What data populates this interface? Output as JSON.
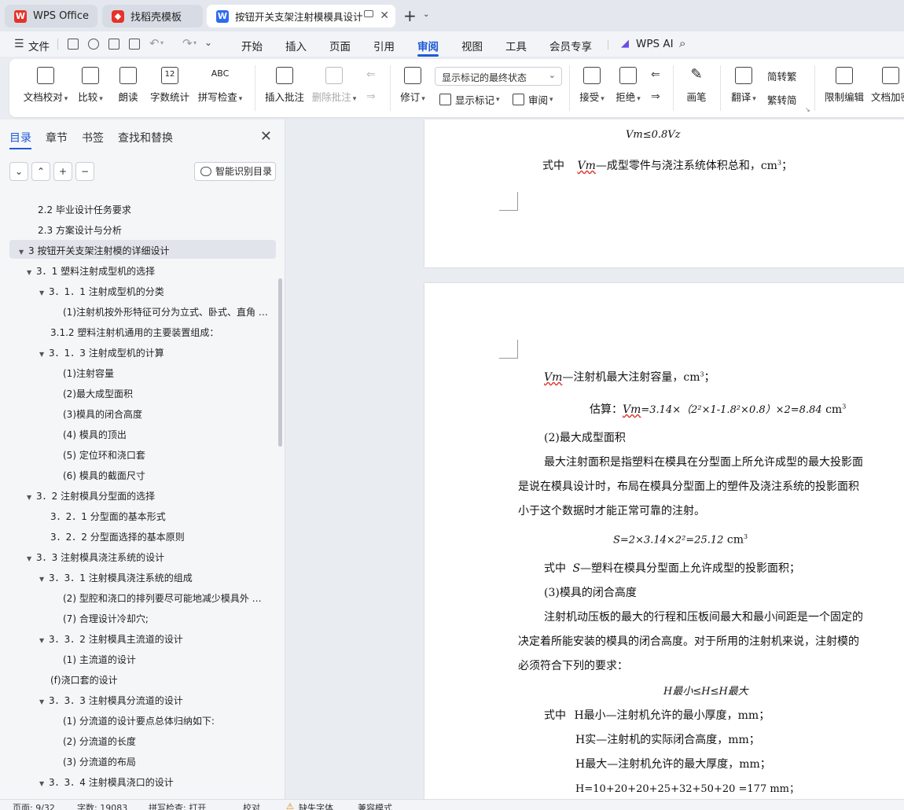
{
  "tabs": [
    {
      "label": "WPS Office",
      "icon": "wps-logo-icon"
    },
    {
      "label": "找稻壳模板",
      "icon": "docer-icon"
    },
    {
      "label": "按钮开关支架注射模模具设计",
      "icon": "writer-doc-icon"
    }
  ],
  "menu": {
    "file": "文件",
    "items": [
      "开始",
      "插入",
      "页面",
      "引用",
      "审阅",
      "视图",
      "工具",
      "会员专享"
    ],
    "active": "审阅",
    "ai": "WPS AI"
  },
  "ribbon": {
    "doc_check": "文档校对",
    "compare": "比较",
    "read_aloud": "朗读",
    "word_count": "字数统计",
    "spell_check": "拼写检查",
    "spell_icon_text": "ABC",
    "word_count_icon_text": "12",
    "insert_comment": "插入批注",
    "delete_comment": "删除批注",
    "track_changes": "修订",
    "markup_dropdown": "显示标记的最终状态",
    "show_markup": "显示标记",
    "review": "审阅",
    "accept": "接受",
    "reject": "拒绝",
    "pen": "画笔",
    "translate": "翻译",
    "to_traditional": "简转繁",
    "to_simplified": "繁转简",
    "restrict_edit": "限制编辑",
    "doc_encrypt": "文档加密"
  },
  "side": {
    "tabs": [
      "目录",
      "章节",
      "书签",
      "查找和替换"
    ],
    "active_tab": "目录",
    "smart_btn": "智能识别目录",
    "toc": [
      {
        "text": "2.2   毕业设计任务要求",
        "level": 1,
        "tri": ""
      },
      {
        "text": "2.3   方案设计与分析",
        "level": 1,
        "tri": ""
      },
      {
        "text": "3   按钮开关支架注射模的详细设计",
        "level": 0,
        "tri": "▼",
        "selected": true
      },
      {
        "text": "3．1   塑料注射成型机的选择",
        "level": 1,
        "tri": "▼"
      },
      {
        "text": "3．1．1   注射成型机的分类",
        "level": 2,
        "tri": "▼"
      },
      {
        "text": "(1)注射机按外形特征可分为立式、卧式、直角 …",
        "level": 3,
        "tri": ""
      },
      {
        "text": "3.1.2   塑料注射机通用的主要装置组成：",
        "level": 2,
        "tri": ""
      },
      {
        "text": "3．1．3   注射成型机的计算",
        "level": 2,
        "tri": "▼"
      },
      {
        "text": "(1)注射容量",
        "level": 3,
        "tri": ""
      },
      {
        "text": "(2)最大成型面积",
        "level": 3,
        "tri": ""
      },
      {
        "text": "(3)模具的闭合高度",
        "level": 3,
        "tri": ""
      },
      {
        "text": "(4)  模具的顶出",
        "level": 3,
        "tri": ""
      },
      {
        "text": "(5)  定位环和浇口套",
        "level": 3,
        "tri": ""
      },
      {
        "text": "(6)  模具的截面尺寸",
        "level": 3,
        "tri": ""
      },
      {
        "text": "3．2   注射模具分型面的选择",
        "level": 1,
        "tri": "▼"
      },
      {
        "text": "3．2．1    分型面的基本形式",
        "level": 2,
        "tri": ""
      },
      {
        "text": "3．2．2 分型面选择的基本原则",
        "level": 2,
        "tri": ""
      },
      {
        "text": "3．3   注射模具浇注系统的设计",
        "level": 1,
        "tri": "▼"
      },
      {
        "text": "3．3．1   注射模具浇注系统的组成",
        "level": 2,
        "tri": "▼"
      },
      {
        "text": "(2)  型腔和浇口的排列要尽可能地减少模具外 …",
        "level": 3,
        "tri": ""
      },
      {
        "text": "(7)  合理设计冷却穴;",
        "level": 3,
        "tri": ""
      },
      {
        "text": "3．3．2   注射模具主流道的设计",
        "level": 2,
        "tri": "▼"
      },
      {
        "text": "(1)  主流道的设计",
        "level": 3,
        "tri": ""
      },
      {
        "text": "(f)浇口套的设计",
        "level": 2,
        "tri": ""
      },
      {
        "text": "3．3．3   注射模具分流道的设计",
        "level": 2,
        "tri": "▼"
      },
      {
        "text": "(1)  分流道的设计要点总体归纳如下:",
        "level": 3,
        "tri": ""
      },
      {
        "text": "(2)  分流道的长度",
        "level": 3,
        "tri": ""
      },
      {
        "text": "(3)  分流道的布局",
        "level": 3,
        "tri": ""
      },
      {
        "text": "3．3．4   注射模具浇口的设计",
        "level": 2,
        "tri": "▼"
      }
    ]
  },
  "doc": {
    "p1_formula": "Vm≤0.8Vz",
    "p1_line_prefix": "式中",
    "p1_line_var": "Vm",
    "p1_line_rest": "—成型零件与浇注系统体积总和，cm",
    "p1_line_tail": "；",
    "p2_vm_var": "Vm",
    "p2_vm_rest": "—注射机最大注射容量，cm",
    "p2_vm_tail": "；",
    "p2_est_label": "估算：",
    "p2_est_var": "Vm",
    "p2_est_expr": "=3.14×（2²×1-1.8²×0.8）×2=8.84",
    "p2_est_unit": "cm",
    "p2_h2": "(2)最大成型面积",
    "p2_para1_l1": "最大注射面积是指塑料在模具在分型面上所允许成型的最大投影面",
    "p2_para1_l2": "是说在模具设计时，布局在模具分型面上的塑件及浇注系统的投影面积",
    "p2_para1_l3": "小于这个数据时才能正常可靠的注射。",
    "p2_s_formula": "S=2×3.14×2²=25.12",
    "p2_s_unit": "cm",
    "p2_s_line_prefix": "式中",
    "p2_s_var": "S",
    "p2_s_rest": "—塑料在模具分型面上允许成型的投影面积；",
    "p2_h3": "(3)模具的闭合高度",
    "p2_para2_l1": "注射机动压板的最大的行程和压板间最大和最小间距是一个固定的",
    "p2_para2_l2": "决定着所能安装的模具的闭合高度。对于所用的注射机来说，注射模的",
    "p2_para2_l3": "必须符合下列的要求：",
    "p2_h_formula": "H最小≤H≤H最大",
    "p2_hmin_prefix": "式中",
    "p2_hmin": "H最小—注射机允许的最小厚度，mm；",
    "p2_h": "H实—注射机的实际闭合高度，mm；",
    "p2_hmax": "H最大—注射机允许的最大厚度，mm；",
    "p2_hsum": "H=10+20+20+25+32+50+20 =177 mm；",
    "superscript_3": "3",
    "superscript_2": "2"
  },
  "status": {
    "page": "页面: 9/32",
    "words": "字数: 19083",
    "spell": "拼写检查: 打开",
    "proof": "校对",
    "missing_font": "缺失字体",
    "compat": "兼容模式"
  },
  "colors": {
    "accent": "#1e5ad6",
    "tab_active_bg": "#ffffff",
    "tab_bar_bg": "#e4e8ee",
    "wps_red": "#e5332a",
    "writer_blue": "#2f6bf0"
  }
}
